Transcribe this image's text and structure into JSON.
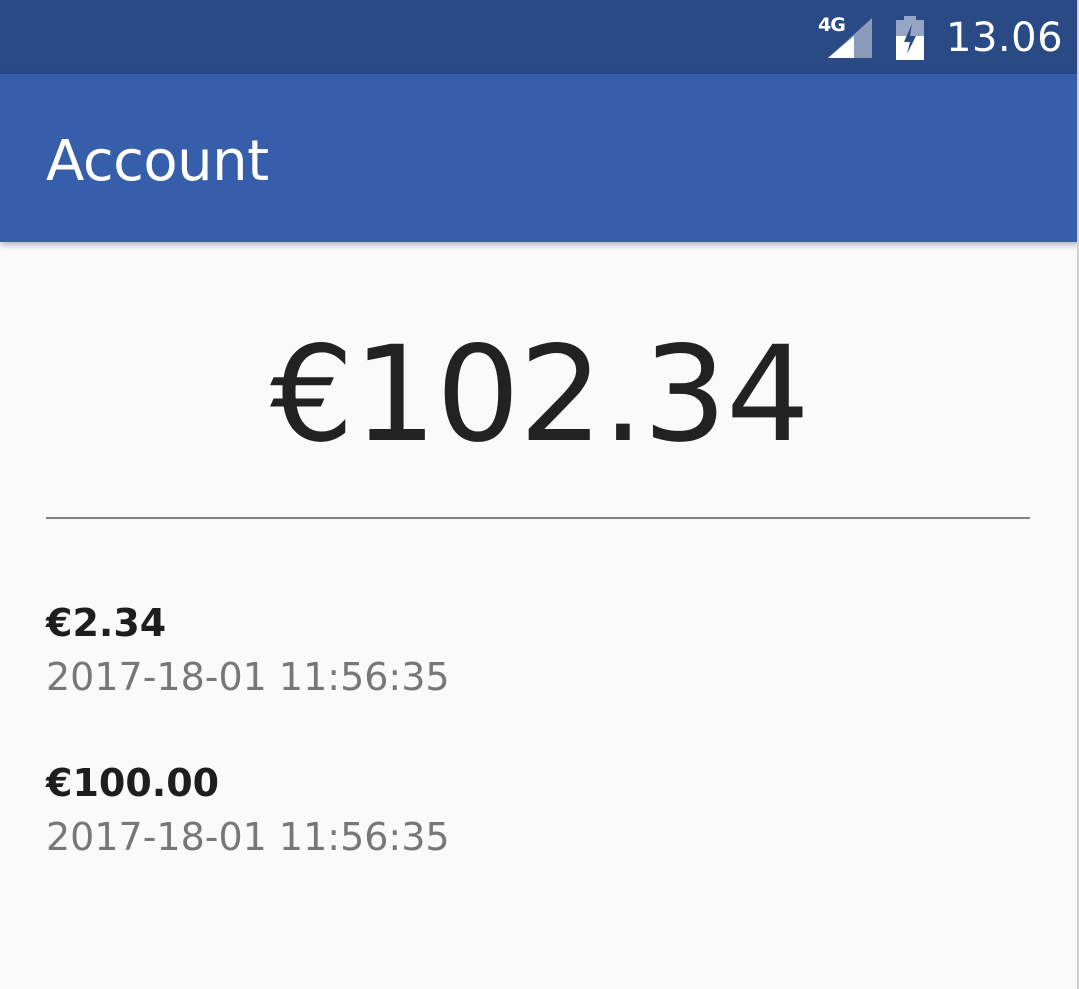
{
  "status_bar": {
    "network": "4G",
    "time": "13.06",
    "icons": [
      "signal-icon",
      "battery-charging-icon"
    ]
  },
  "app_bar": {
    "title": "Account"
  },
  "balance": {
    "amount": "€102.34"
  },
  "transactions": [
    {
      "amount": "€2.34",
      "timestamp": "2017-18-01 11:56:35"
    },
    {
      "amount": "€100.00",
      "timestamp": "2017-18-01 11:56:35"
    }
  ],
  "colors": {
    "status_bar": "#2a4a86",
    "app_bar": "#365eab",
    "background": "#fafafa"
  }
}
